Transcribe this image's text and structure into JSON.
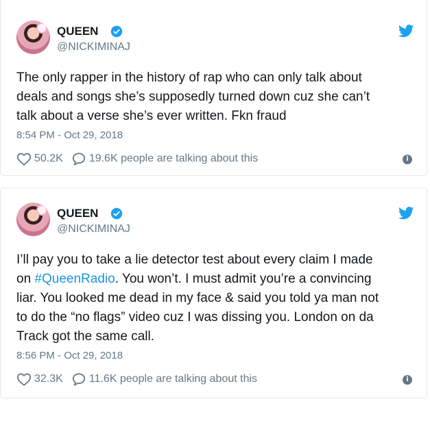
{
  "tweets": [
    {
      "name": "QUEEN",
      "handle": "@NICKIMINAJ",
      "text_lines": [
        "The only rapper in the history of rap who can only talk about",
        "deals and songs she’s supposedly turned down cuz she can’t",
        "talk about a verse she’s ever written. Fkn fraud"
      ],
      "time": "8:54 PM - Oct 29, 2018",
      "likes": "50.2K",
      "talking": "19.6K people are talking about this"
    },
    {
      "name": "QUEEN",
      "handle": "@NICKIMINAJ",
      "line1": "I’ll pay you to take a lie detector test about every claim I made",
      "line2_pre": "on ",
      "line2_hashtag": "#QueenRadio",
      "line2_post": ". You won’t. I must admit you’re a convincing",
      "line3": "liar. You looked me dead in my face & said you told ya man not",
      "line4": "to do the “no flags” video cuz I was dissing you. London on da",
      "line5": "Track got the same call.",
      "time": "8:56 PM - Oct 29, 2018",
      "likes": "32.3K",
      "talking": "11.6K people are talking about this"
    }
  ],
  "colors": {
    "verified": "#1da1f2",
    "twitter_bird": "#1da1f2",
    "hashtag": "#1b95e0",
    "secondary_text": "#657786",
    "border": "#e1e8ed"
  },
  "icons": [
    "verified-badge-icon",
    "twitter-bird-icon",
    "heart-icon",
    "reply-bubble-icon",
    "info-icon"
  ]
}
